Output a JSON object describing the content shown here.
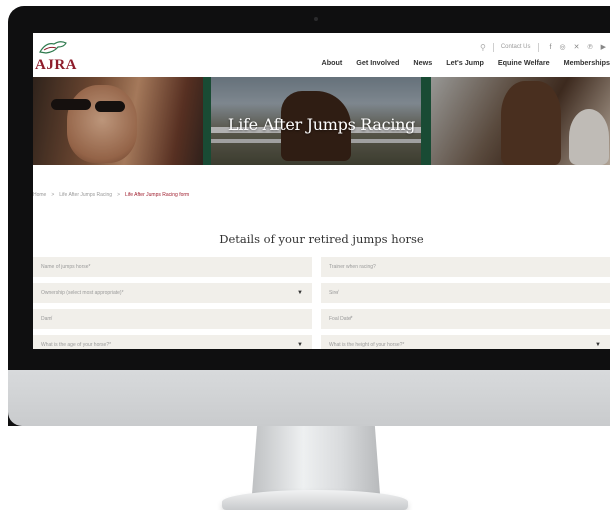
{
  "site": {
    "logo_text": "AJRA",
    "utility": {
      "search_icon": "search-icon",
      "contact_label": "Contact Us"
    },
    "social_icons": [
      "facebook-icon",
      "instagram-icon",
      "twitter-icon",
      "pinterest-icon",
      "youtube-icon"
    ],
    "social_glyphs": [
      "f",
      "◎",
      "✕",
      "℗",
      "▶"
    ],
    "nav": [
      "About",
      "Get Involved",
      "News",
      "Let's Jump",
      "Equine Welfare",
      "Memberships"
    ]
  },
  "hero": {
    "title": "Life After Jumps Racing"
  },
  "breadcrumb": {
    "home": "Home",
    "parent": "Life After Jumps Racing",
    "current": "Life After Jumps Racing form"
  },
  "form": {
    "title": "Details of your retired jumps horse",
    "fields": {
      "horse_name": "Name of jumps horse*",
      "trainer": "Trainer when racing?",
      "ownership": "Ownership (select most appropriate)*",
      "sire": "Sire̸",
      "dam": "Dam̸",
      "foal_date": "Foal Date̸*",
      "age": "What is the age of your horse?*",
      "height": "What is the height of your horse?*"
    }
  },
  "colors": {
    "brand": "#8e1c2b",
    "field_bg": "#f1efea",
    "hero_divider": "#1f5c40"
  }
}
